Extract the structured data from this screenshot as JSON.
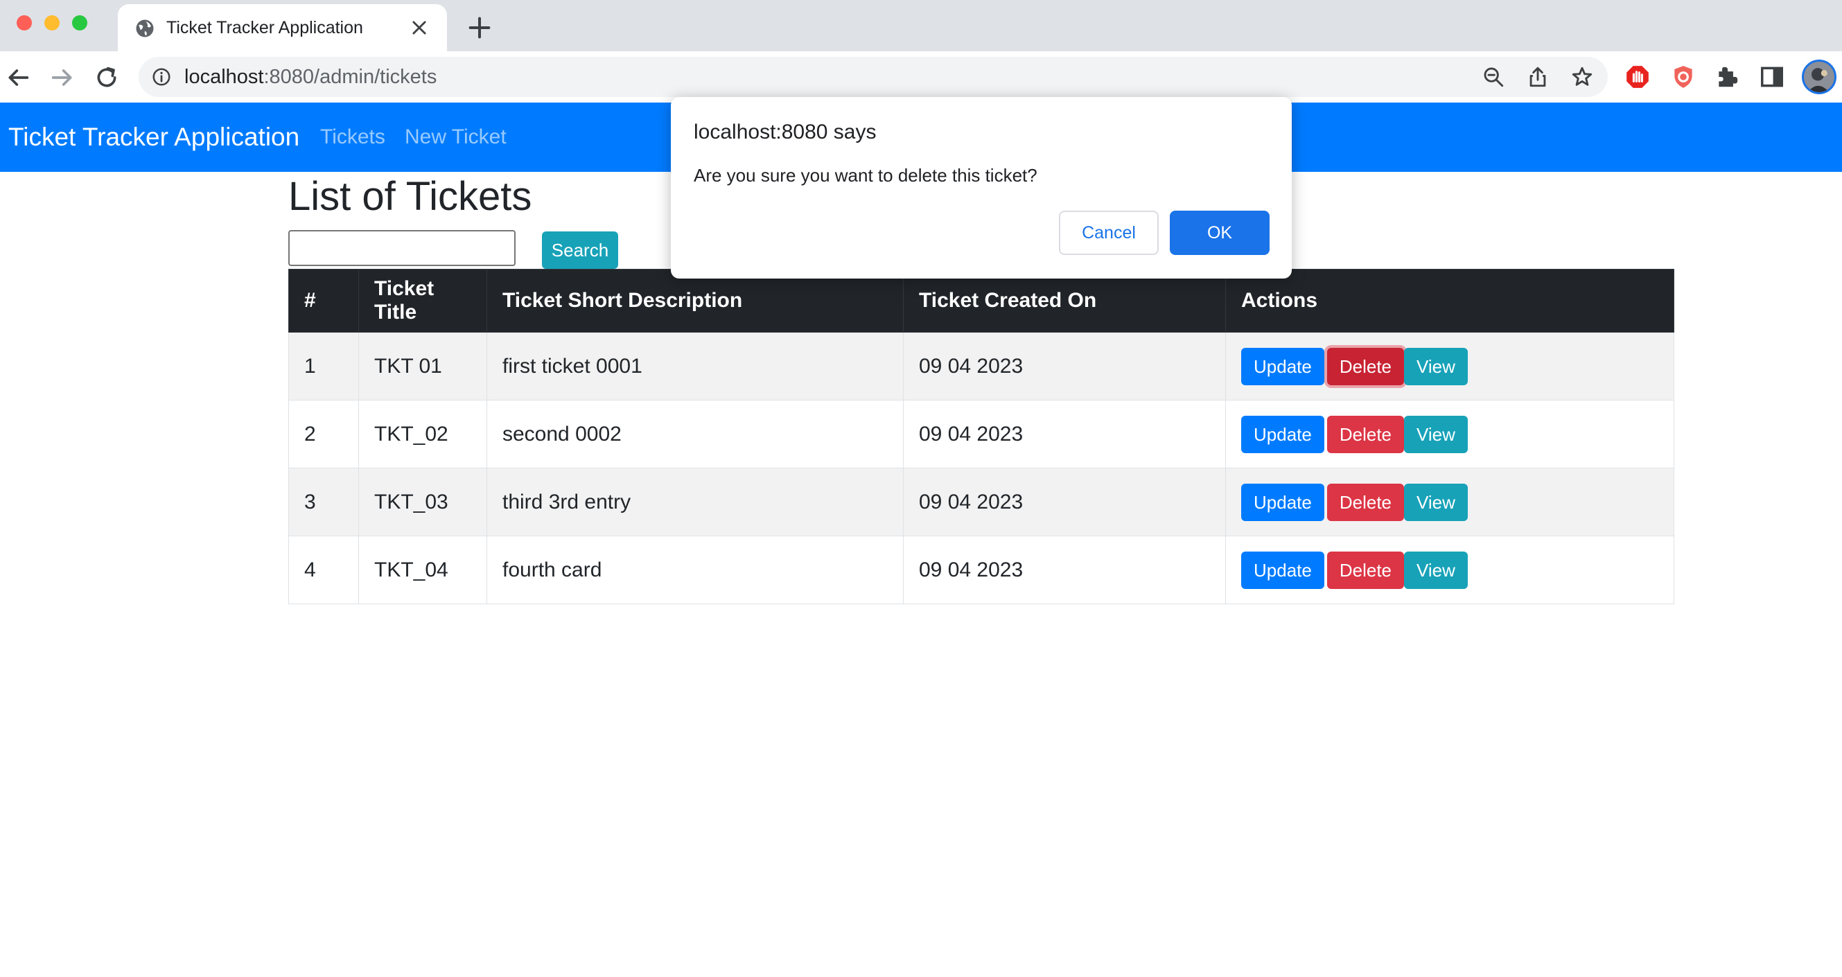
{
  "browser": {
    "tab_title": "Ticket Tracker Application",
    "url_host": "localhost",
    "url_rest": ":8080/admin/tickets"
  },
  "navbar": {
    "brand": "Ticket Tracker Application",
    "links": [
      "Tickets",
      "New Ticket"
    ],
    "color": "#007bff"
  },
  "page": {
    "title": "List of Tickets",
    "search_value": "",
    "search_button": "Search"
  },
  "table": {
    "headers": [
      "#",
      "Ticket Title",
      "Ticket Short Description",
      "Ticket Created On",
      "Actions"
    ],
    "rows": [
      {
        "num": "1",
        "title": "TKT 01",
        "description": "first ticket 0001",
        "created": "09 04 2023"
      },
      {
        "num": "2",
        "title": "TKT_02",
        "description": "second 0002",
        "created": "09 04 2023"
      },
      {
        "num": "3",
        "title": "TKT_03",
        "description": "third 3rd entry",
        "created": "09 04 2023"
      },
      {
        "num": "4",
        "title": "TKT_04",
        "description": "fourth card",
        "created": "09 04 2023"
      }
    ],
    "actions": {
      "update": "Update",
      "delete": "Delete",
      "view": "View"
    }
  },
  "dialog": {
    "origin": "localhost:8080 says",
    "message": "Are you sure you want to delete this ticket?",
    "cancel": "Cancel",
    "ok": "OK"
  },
  "colors": {
    "update": "#007bff",
    "delete": "#dc3545",
    "view": "#17a2b8",
    "header": "#212529"
  }
}
